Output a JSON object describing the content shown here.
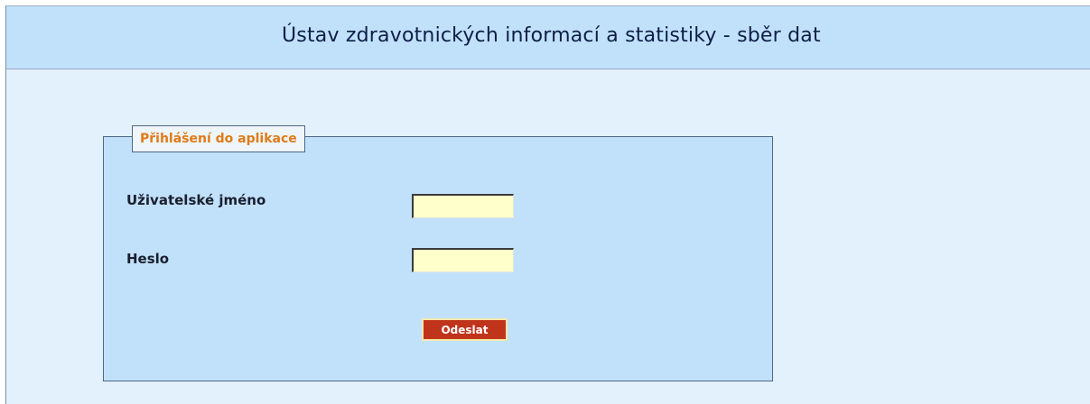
{
  "header": {
    "title": "Ústav zdravotnických informací a statistiky - sběr dat"
  },
  "login": {
    "legend": "Přihlášení do aplikace",
    "username_label": "Uživatelské jméno",
    "username_value": "",
    "password_label": "Heslo",
    "password_value": "",
    "submit_label": "Odeslat"
  },
  "colors": {
    "header_background": "#c1e1fb",
    "page_background": "#e3f1fd",
    "legend_text": "#e07b17",
    "input_background": "#ffffcc",
    "button_background": "#c0341c"
  }
}
